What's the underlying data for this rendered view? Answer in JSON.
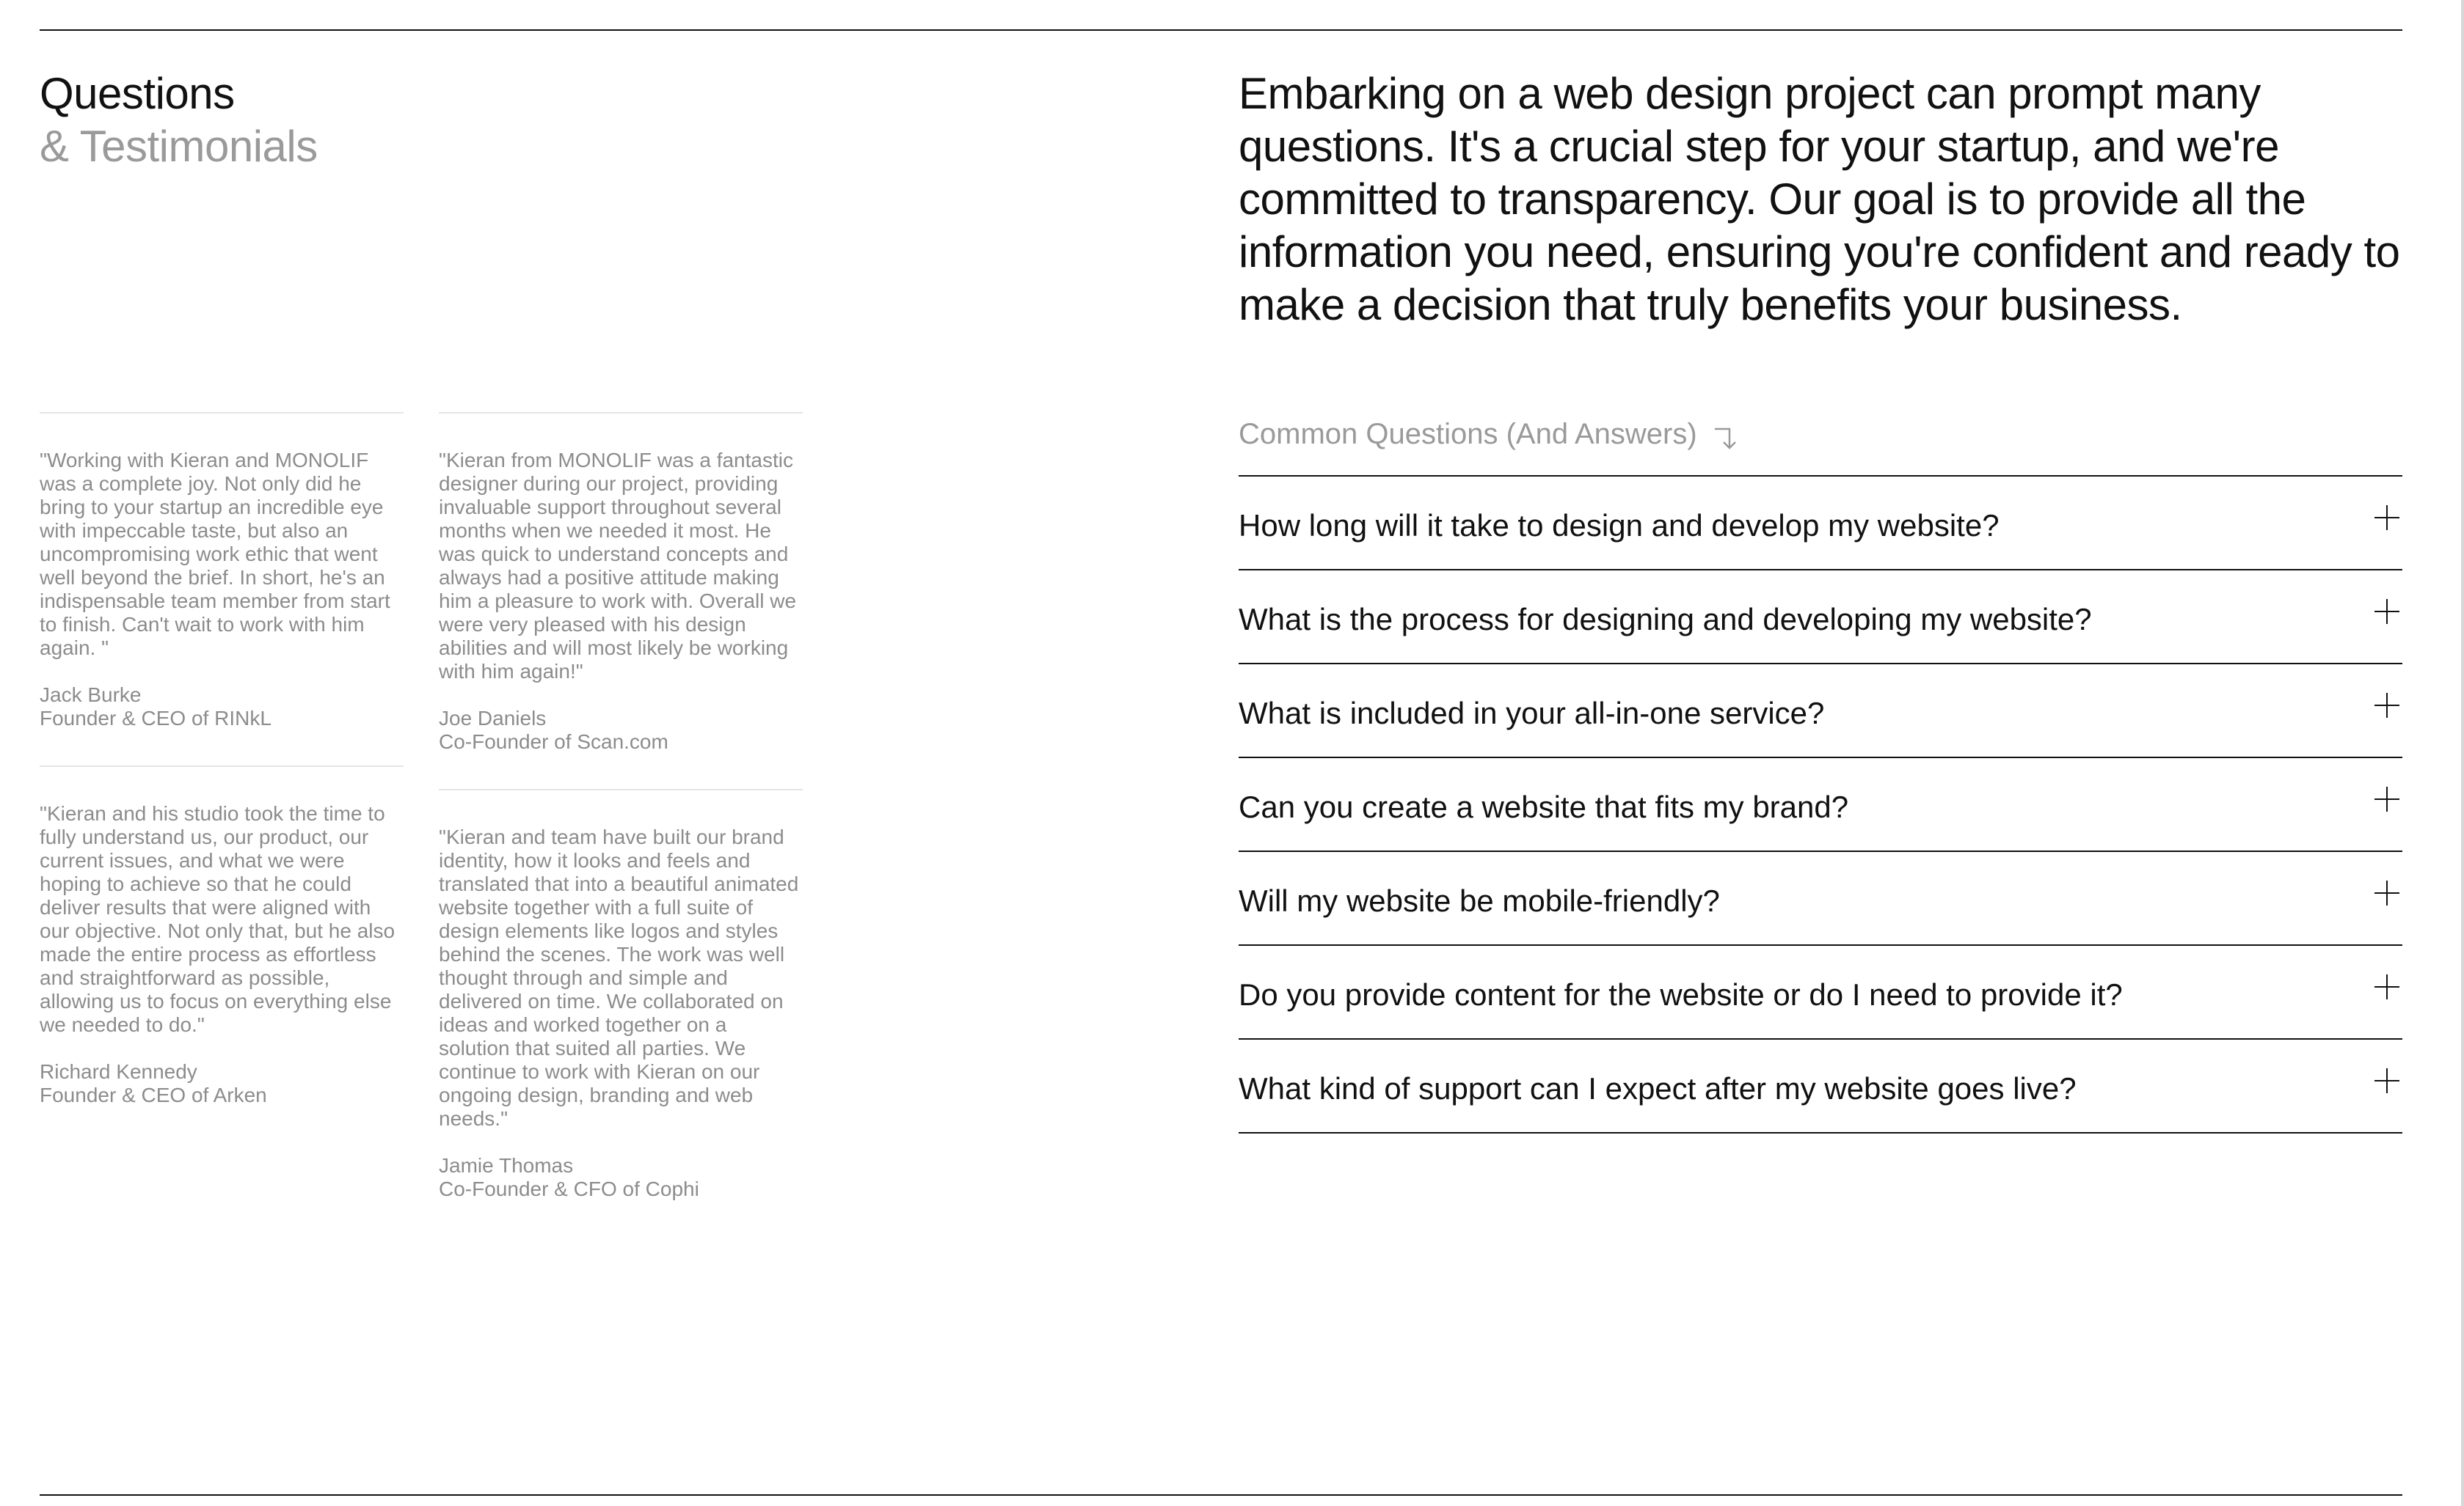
{
  "heading": {
    "line1": "Questions",
    "line2": "& Testimonials"
  },
  "intro": "Embarking on a web design project can prompt many questions. It's a crucial step for your startup, and we're committed to transparency. Our goal is to provide all the information you need, ensuring you're confident and ready to make a decision that truly benefits your business.",
  "testimonials": {
    "col1": [
      {
        "quote": "\"Working with Kieran and MONOLIF was a complete joy. Not only did he bring to your startup an incredible eye with impeccable taste, but also an uncompromising work ethic that went well beyond the brief. In short, he's an indispensable team member from start to finish. Can't wait to work with him again. \"",
        "author": "Jack Burke",
        "role": "Founder & CEO of RINkL"
      },
      {
        "quote": "\"Kieran and his studio took the time to fully understand us, our product, our current issues, and what we were hoping to achieve so that he could deliver results that were aligned with our objective. Not only that, but he also made the entire process as effortless and straightforward as possible, allowing us to focus on everything else we needed to do.\"",
        "author": "Richard Kennedy",
        "role": "Founder & CEO of Arken"
      }
    ],
    "col2": [
      {
        "quote": "\"Kieran from MONOLIF was a fantastic designer during our project, providing invaluable support throughout several months when we needed it most. He was quick to understand concepts and always had a positive attitude making him a pleasure to work with. Overall we were very pleased with his design abilities and will most likely be working with him again!\"",
        "author": "Joe Daniels",
        "role": "Co-Founder of Scan.com"
      },
      {
        "quote": "\"Kieran and team have built our brand identity, how it looks and feels and translated that into a beautiful animated website together with a full suite of design elements like logos and styles behind the scenes. The work was well thought through and simple and delivered on time. We collaborated on ideas and worked together on a solution that suited all parties. We continue to work with Kieran on our ongoing design, branding and web needs.\"",
        "author": "Jamie Thomas",
        "role": "Co-Founder & CFO of Cophi"
      }
    ]
  },
  "faq": {
    "label": "Common Questions (And Answers)",
    "label_icon": "arrow-down-right-icon",
    "toggle_icon": "plus-icon",
    "items": [
      "How long will it take to design and develop my website?",
      "What is the process for designing and developing my website?",
      "What is included in your all-in-one service?",
      "Can you create a website that fits my brand?",
      "Will my website be mobile-friendly?",
      "Do you provide content for the website or do I need to provide it?",
      "What kind of support can I expect after my website goes live?"
    ]
  },
  "colors": {
    "text": "#111111",
    "muted": "#9a9a9a",
    "testimonial_text": "#8c8c8c",
    "divider": "#e4e4e4",
    "background": "#ffffff"
  }
}
